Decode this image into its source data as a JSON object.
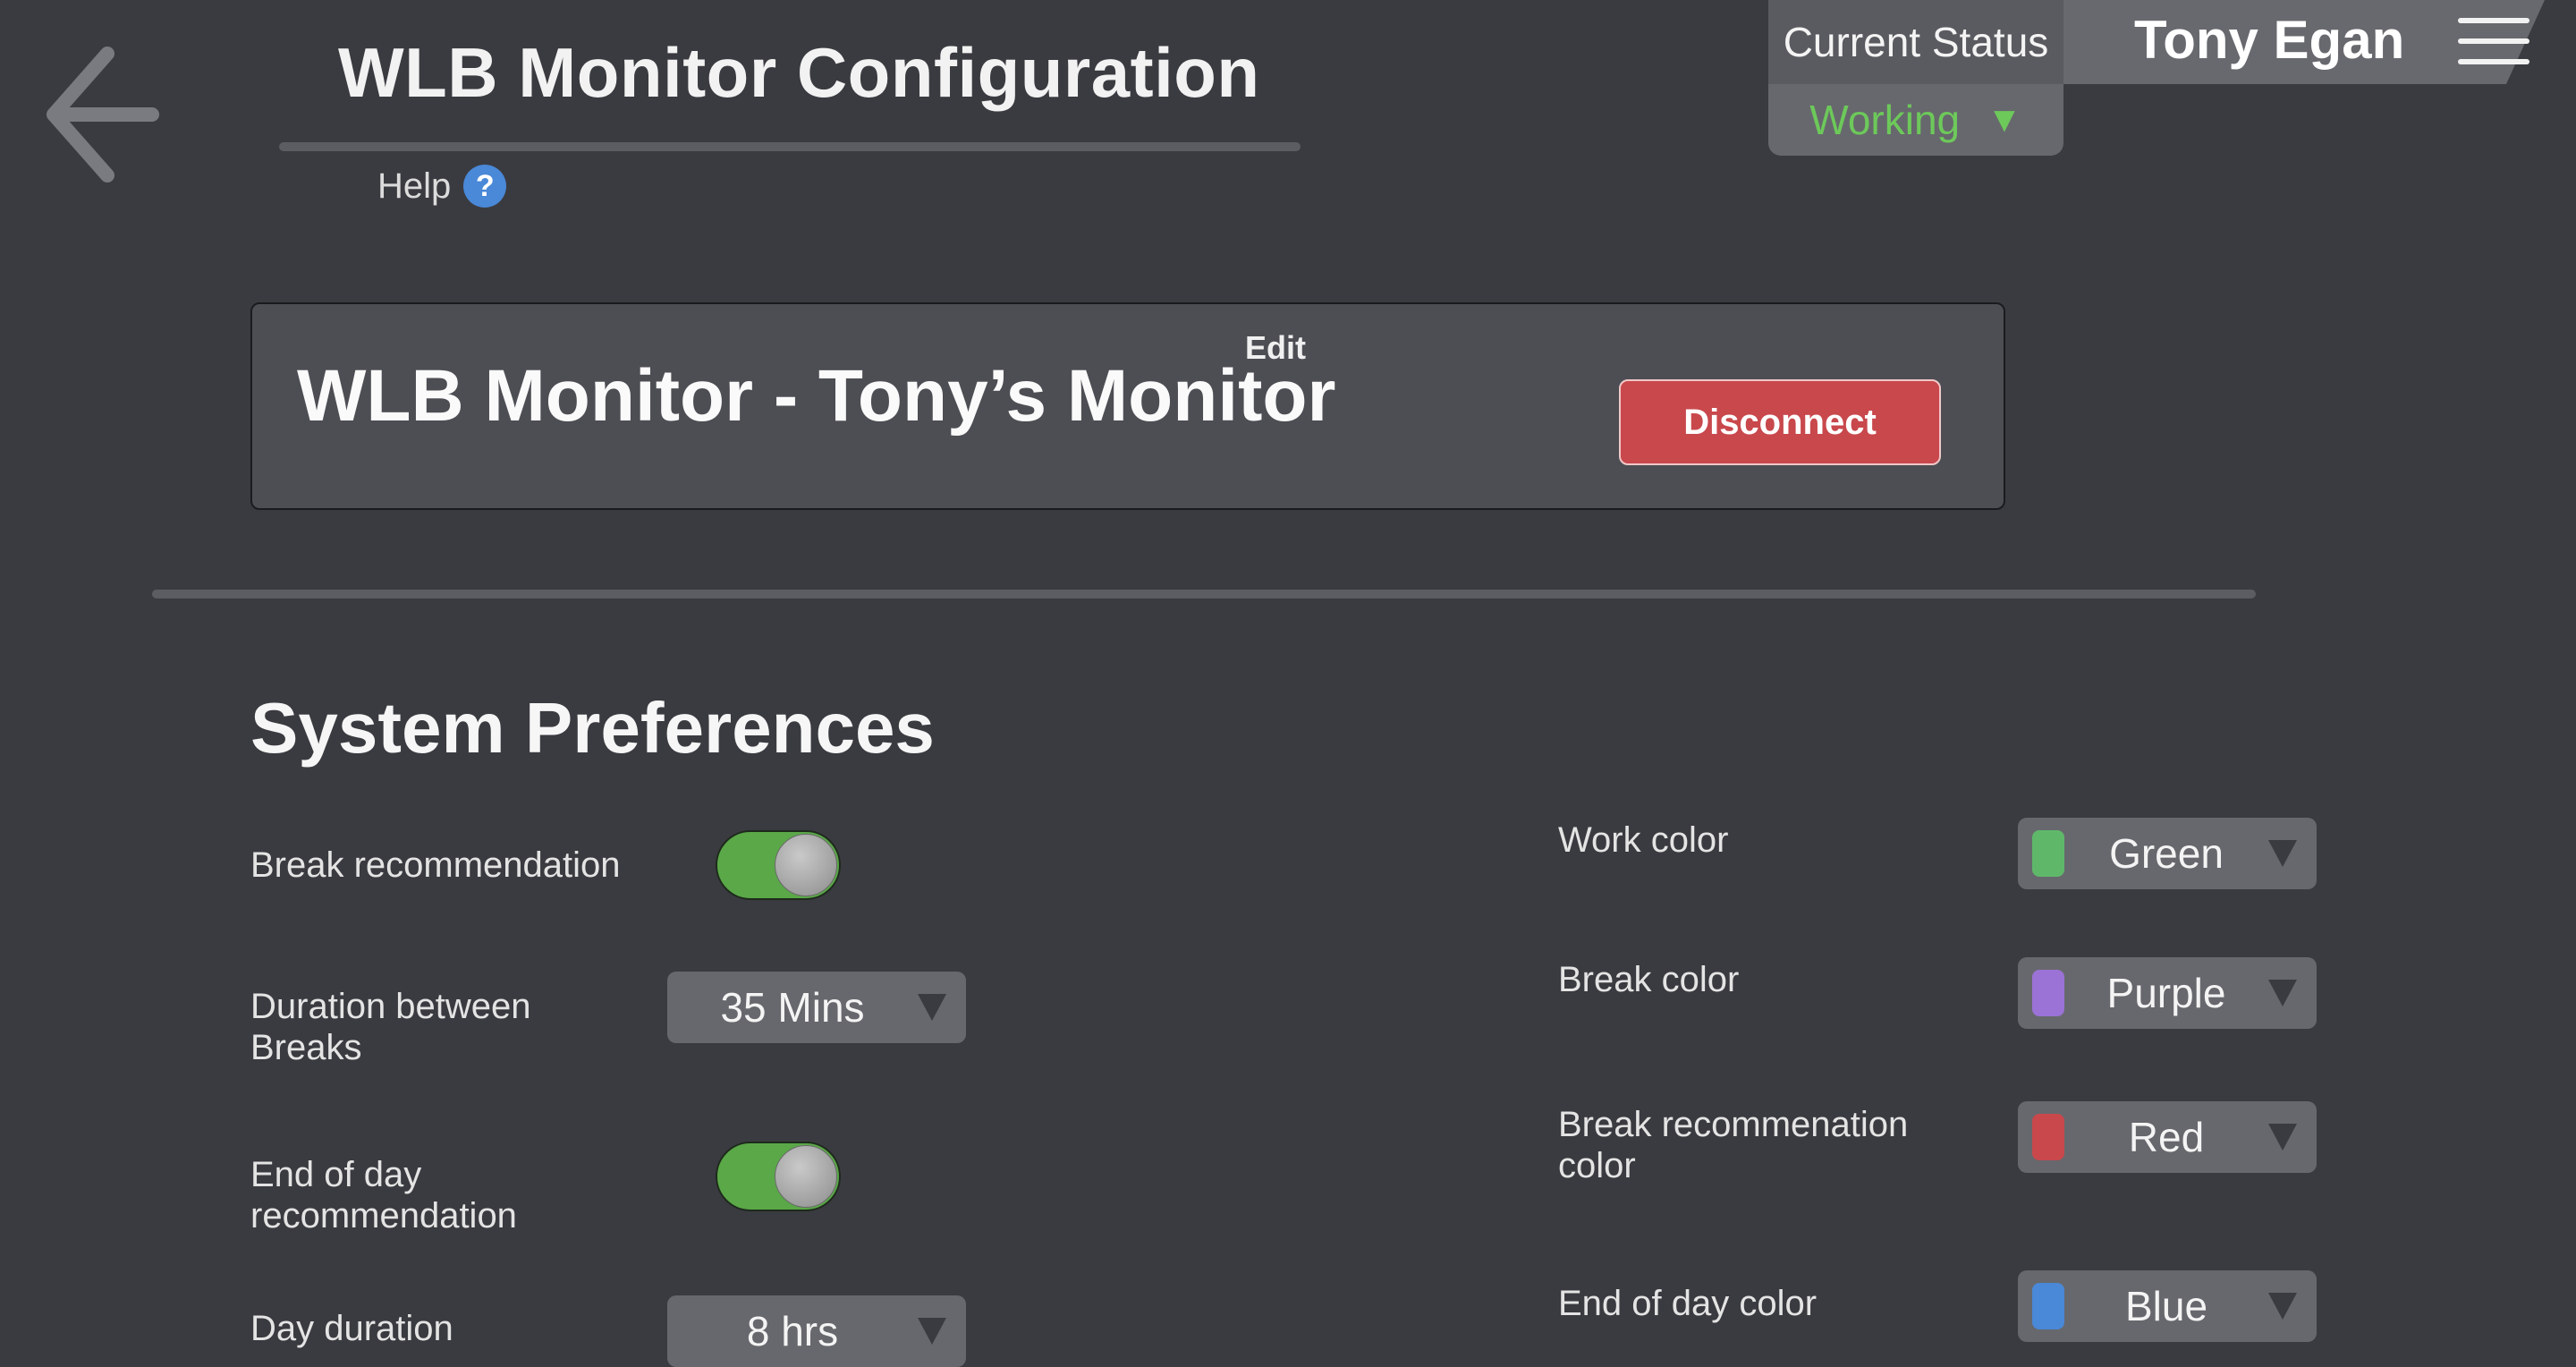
{
  "header": {
    "title": "WLB Monitor Configuration",
    "help_label": "Help",
    "help_icon": "question-circle-icon"
  },
  "status": {
    "label": "Current Status",
    "value": "Working",
    "value_color": "#6dc95a",
    "arrow": "▼"
  },
  "user": {
    "name": "Tony Egan"
  },
  "device": {
    "name": "WLB Monitor - Tony’s Monitor",
    "edit_label": "Edit",
    "disconnect_label": "Disconnect"
  },
  "preferences": {
    "title": "System Preferences",
    "left": [
      {
        "label": "Break recommendation",
        "type": "toggle",
        "on": true
      },
      {
        "label_lines": [
          "Duration between",
          "Breaks"
        ],
        "type": "select",
        "value": "35 Mins"
      },
      {
        "label_lines": [
          "End of day",
          "recommendation"
        ],
        "type": "toggle",
        "on": true
      },
      {
        "label": "Day duration",
        "type": "select",
        "value": "8 hrs"
      }
    ],
    "right": [
      {
        "label": "Work color",
        "value": "Green",
        "swatch": "#5fb86a"
      },
      {
        "label": "Break color",
        "value": "Purple",
        "swatch": "#9b72d6"
      },
      {
        "label_lines": [
          "Break recommenation",
          "color"
        ],
        "value": "Red",
        "swatch": "#c9484c"
      },
      {
        "label": "End of day color",
        "value": "Blue",
        "swatch": "#4a88d8"
      }
    ]
  },
  "colors": {
    "background": "#3a3b40",
    "toggle_on": "#5aa848",
    "disconnect": "#c8484c",
    "help": "#4a88d8"
  }
}
